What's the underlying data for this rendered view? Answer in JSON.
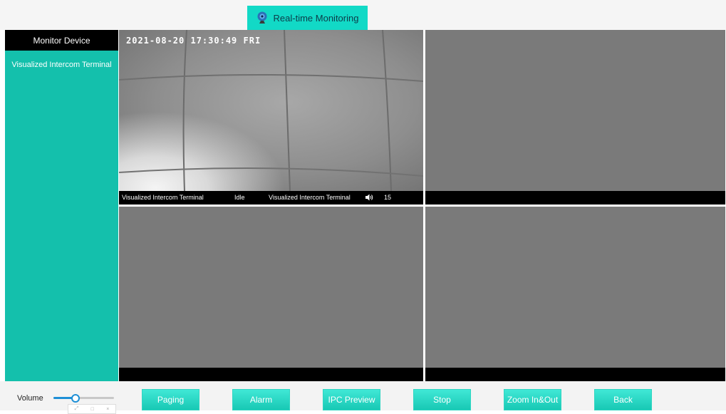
{
  "header": {
    "title": "Real-time Monitoring",
    "icon": "webcam-globe-icon"
  },
  "sidebar": {
    "header": "Monitor Device",
    "items": [
      {
        "label": "Visualized Intercom Terminal"
      }
    ]
  },
  "video": {
    "tile1": {
      "timestamp": "2021-08-20 17:30:49 FRI",
      "device": "Visualized Intercom Terminal",
      "state": "Idle",
      "device2": "Visualized Intercom Terminal",
      "volume": "15",
      "speaker_icon": "speaker-icon"
    }
  },
  "bottom": {
    "volume_label": "Volume",
    "volume_level": 0.35,
    "window_controls": [
      "⤢",
      "□",
      "×"
    ],
    "buttons": [
      "Paging",
      "Alarm",
      "IPC Preview",
      "Stop",
      "Zoom In&Out",
      "Back"
    ]
  },
  "colors": {
    "accent": "#14c0ac",
    "title_tab": "#12d9c6",
    "video_empty": "#7a7a7a",
    "status_bar": "#000000",
    "slider": "#1e8fd6"
  }
}
